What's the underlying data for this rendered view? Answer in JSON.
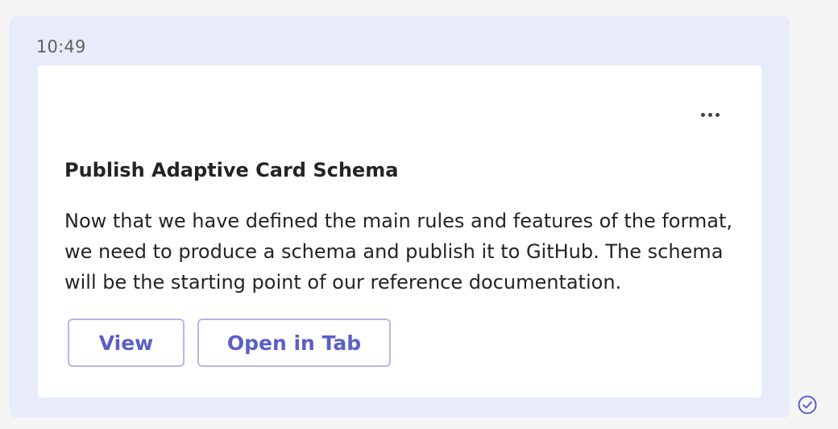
{
  "message": {
    "timestamp": "10:49"
  },
  "card": {
    "more_options_icon": "ellipsis-icon",
    "title": "Publish Adaptive Card Schema",
    "body": "Now that we have defined the main rules and features of the format, we need to produce a schema and publish it to GitHub. The schema will be the starting point of our reference documentation.",
    "actions": [
      {
        "label": "View"
      },
      {
        "label": "Open in Tab"
      }
    ]
  },
  "status": {
    "icon": "sent-check-icon"
  },
  "colors": {
    "page_background": "#f5f5f5",
    "message_background": "#e8ebfa",
    "card_background": "#ffffff",
    "accent": "#5b5fc7",
    "button_border": "#b4b8ea",
    "text": "#242424",
    "timestamp": "#616161"
  }
}
